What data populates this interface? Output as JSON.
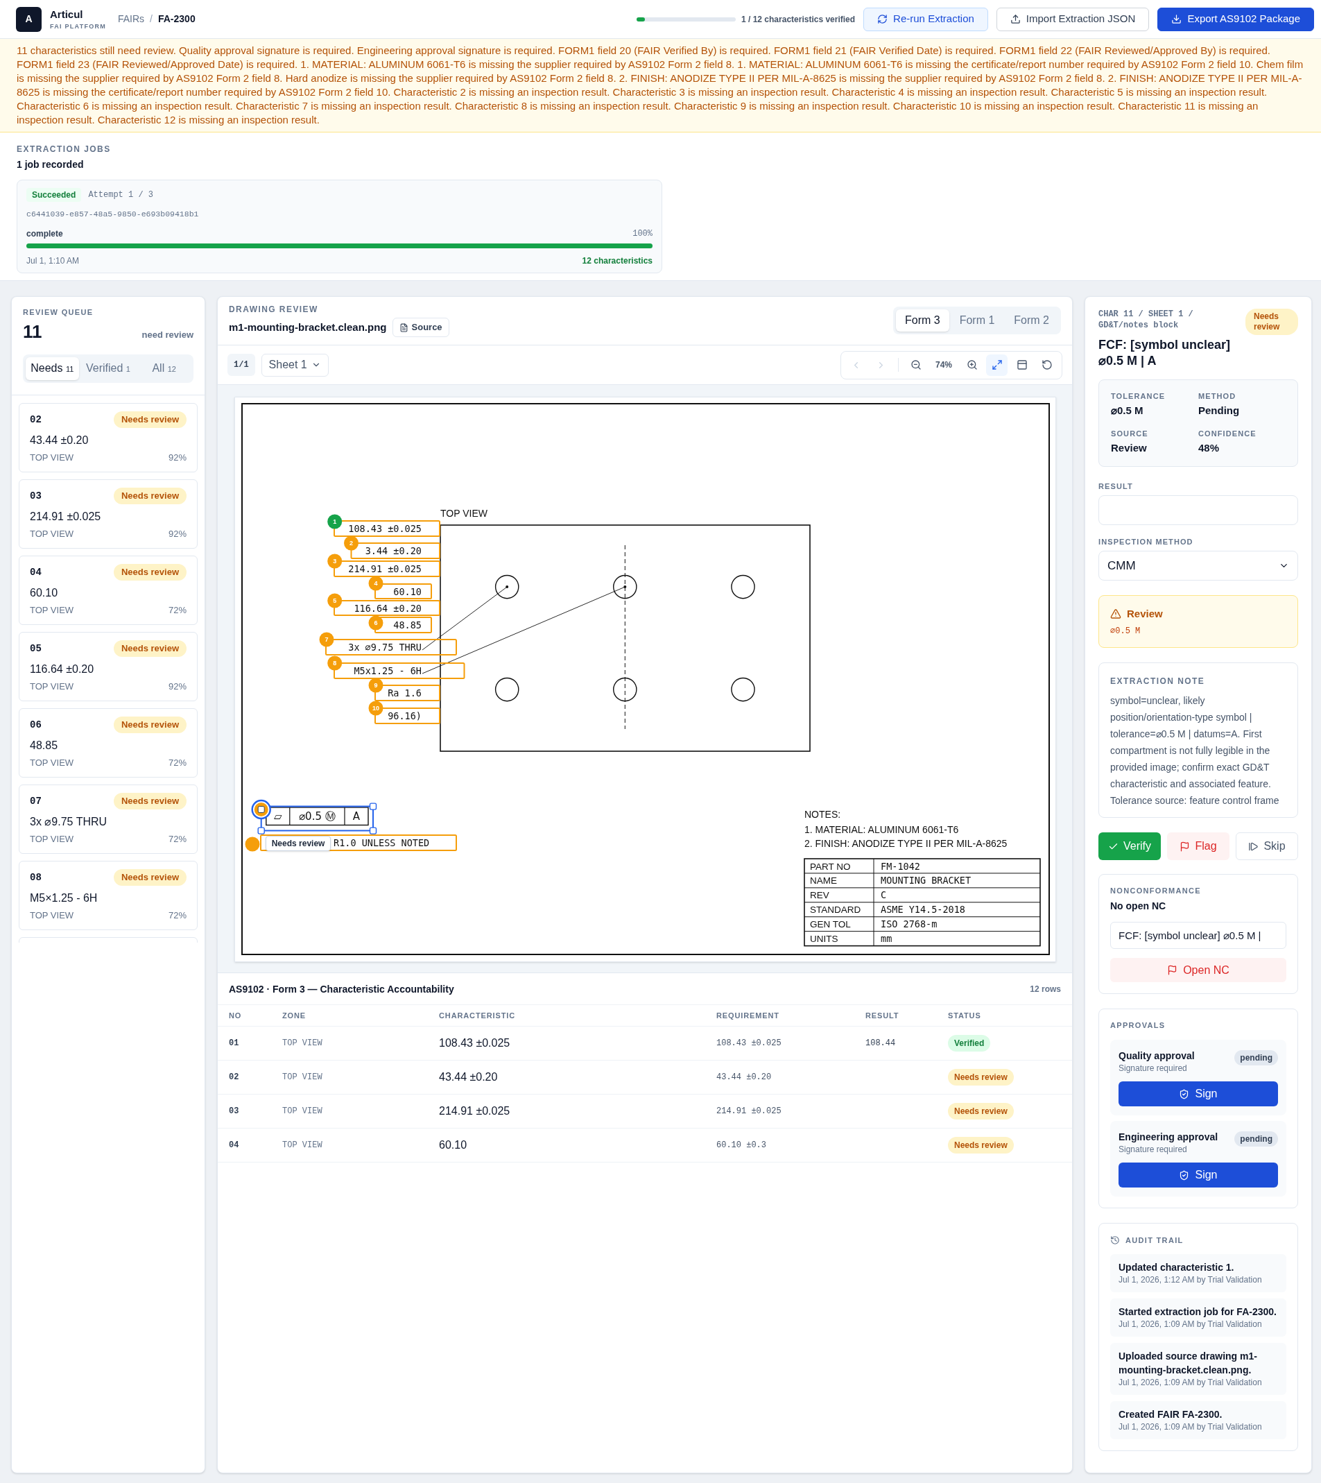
{
  "header": {
    "logo": "A",
    "brand": "Articul",
    "tagline": "FAI PLATFORM",
    "breadcrumb": {
      "items": [
        "FAIRs",
        "FA-2300"
      ],
      "separator": "/"
    },
    "progress": {
      "level": 0.083,
      "label": "1 / 12 characteristics verified"
    },
    "buttons": [
      {
        "label": "Re-run Extraction",
        "kind": "rerun"
      },
      {
        "label": "Import Extraction JSON",
        "kind": "import"
      },
      {
        "label": "Export AS9102 Package",
        "kind": "export"
      }
    ]
  },
  "warning": "11 characteristics still need review. Quality approval signature is required. Engineering approval signature is required. FORM1 field 20 (FAIR Verified By) is required. FORM1 field 21 (FAIR Verified Date) is required. FORM1 field 22 (FAIR Reviewed/Approved By) is required. FORM1 field 23 (FAIR Reviewed/Approved Date) is required. 1. MATERIAL: ALUMINUM 6061-T6 is missing the supplier required by AS9102 Form 2 field 8. 1. MATERIAL: ALUMINUM 6061-T6 is missing the certificate/report number required by AS9102 Form 2 field 10. Chem film is missing the supplier required by AS9102 Form 2 field 8. Hard anodize is missing the supplier required by AS9102 Form 2 field 8. 2. FINISH: ANODIZE TYPE II PER MIL-A-8625 is missing the supplier required by AS9102 Form 2 field 8. 2. FINISH: ANODIZE TYPE II PER MIL-A-8625 is missing the certificate/report number required by AS9102 Form 2 field 10. Characteristic 2 is missing an inspection result. Characteristic 3 is missing an inspection result. Characteristic 4 is missing an inspection result. Characteristic 5 is missing an inspection result. Characteristic 6 is missing an inspection result. Characteristic 7 is missing an inspection result. Characteristic 8 is missing an inspection result. Characteristic 9 is missing an inspection result. Characteristic 10 is missing an inspection result. Characteristic 11 is missing an inspection result. Characteristic 12 is missing an inspection result.",
  "extraction_jobs": {
    "title": "EXTRACTION JOBS",
    "summary": "1 job recorded",
    "jobs": [
      {
        "status": "Succeeded",
        "attempt": "Attempt 1 / 3",
        "uuid": "c6441039-e857-48a5-9850-e693b09418b1",
        "stage": "complete",
        "percent": "100%",
        "level": 1,
        "time": "Jul 1, 1:10 AM",
        "result": "12 characteristics"
      }
    ]
  },
  "review_queue": {
    "title": "REVIEW QUEUE",
    "count": "11",
    "count_label": "need review",
    "tabs": [
      {
        "label": "Needs",
        "count": "11",
        "selected": true
      },
      {
        "label": "Verified",
        "count": "1",
        "selected": false
      },
      {
        "label": "All",
        "count": "12",
        "selected": false
      }
    ],
    "items": [
      {
        "no": "02",
        "status": {
          "label": "Needs review",
          "kind": "review"
        },
        "value": "43.44 ±0.20",
        "zone": "TOP VIEW",
        "confidence": "92%"
      },
      {
        "no": "03",
        "status": {
          "label": "Needs review",
          "kind": "review"
        },
        "value": "214.91 ±0.025",
        "zone": "TOP VIEW",
        "confidence": "92%"
      },
      {
        "no": "04",
        "status": {
          "label": "Needs review",
          "kind": "review"
        },
        "value": "60.10",
        "zone": "TOP VIEW",
        "confidence": "72%"
      },
      {
        "no": "05",
        "status": {
          "label": "Needs review",
          "kind": "review"
        },
        "value": "116.64 ±0.20",
        "zone": "TOP VIEW",
        "confidence": "92%"
      },
      {
        "no": "06",
        "status": {
          "label": "Needs review",
          "kind": "review"
        },
        "value": "48.85",
        "zone": "TOP VIEW",
        "confidence": "72%"
      },
      {
        "no": "07",
        "status": {
          "label": "Needs review",
          "kind": "review"
        },
        "value": "3x ⌀9.75 THRU",
        "zone": "TOP VIEW",
        "confidence": "72%"
      },
      {
        "no": "08",
        "status": {
          "label": "Needs review",
          "kind": "review"
        },
        "value": "M5×1.25 - 6H",
        "zone": "TOP VIEW",
        "confidence": "72%"
      }
    ]
  },
  "drawing_review": {
    "title": "DRAWING REVIEW",
    "file": "m1-mounting-bracket.clean.png",
    "source_button": "Source",
    "form_tabs": [
      {
        "label": "Form 3",
        "selected": true
      },
      {
        "label": "Form 1",
        "selected": false
      },
      {
        "label": "Form 2",
        "selected": false
      }
    ],
    "page": "1/1",
    "sheet": "Sheet 1",
    "toolbar": {
      "zoom": "74%",
      "fit_selected": true,
      "nav_disabled": true
    },
    "drawing": {
      "view_label": "TOP VIEW",
      "callouts": [
        {
          "kind": "dimension",
          "number": "1",
          "text": "108.43 ±0.025",
          "verified": true,
          "selected": false
        },
        {
          "kind": "dimension",
          "number": "2",
          "text": "3.44 ±0.20",
          "verified": false,
          "selected": false
        },
        {
          "kind": "dimension",
          "number": "3",
          "text": "214.91 ±0.025",
          "verified": false,
          "selected": false
        },
        {
          "kind": "dimension",
          "number": "4",
          "text": "60.10",
          "verified": false,
          "selected": false
        },
        {
          "kind": "dimension",
          "number": "5",
          "text": "116.64 ±0.20",
          "verified": false,
          "selected": false
        },
        {
          "kind": "dimension",
          "number": "6",
          "text": "48.85",
          "verified": false,
          "selected": false
        },
        {
          "kind": "dimension",
          "number": "7",
          "text": "3x ⌀9.75 THRU",
          "verified": false,
          "selected": false
        },
        {
          "kind": "dimension",
          "number": "8",
          "text": "M5x1.25 - 6H",
          "verified": false,
          "selected": false
        },
        {
          "kind": "dimension",
          "number": "9",
          "text": "Ra 1.6",
          "verified": false,
          "selected": false
        },
        {
          "kind": "dimension",
          "number": "10",
          "text": "96.16)",
          "verified": false,
          "selected": false
        },
        {
          "kind": "fcf",
          "cells": [
            "▱",
            "⌀0.5 Ⓜ",
            "A"
          ],
          "verified": false,
          "selected": true,
          "tooltip": "Needs review"
        },
        {
          "kind": "dimension",
          "text": "R1.0 UNLESS NOTED",
          "verified": false,
          "selected": false
        }
      ],
      "notes": {
        "title": "NOTES:",
        "lines": [
          "1. MATERIAL: ALUMINUM 6061-T6",
          "2. FINISH: ANODIZE TYPE II PER MIL-A-8625"
        ]
      },
      "title_block": [
        {
          "label": "PART NO",
          "value": "FM-1042"
        },
        {
          "label": "NAME",
          "value": "MOUNTING BRACKET"
        },
        {
          "label": "REV",
          "value": "C"
        },
        {
          "label": "STANDARD",
          "value": "ASME Y14.5-2018"
        },
        {
          "label": "GEN TOL",
          "value": "ISO 2768-m"
        },
        {
          "label": "UNITS",
          "value": "mm"
        }
      ]
    },
    "table": {
      "title": "AS9102 · Form 3 — Characteristic Accountability",
      "row_count": "12 rows",
      "columns": [
        "NO",
        "ZONE",
        "CHARACTERISTIC",
        "REQUIREMENT",
        "RESULT",
        "STATUS"
      ],
      "rows": [
        {
          "no": "01",
          "zone": "TOP VIEW",
          "characteristic": "108.43 ±0.025",
          "requirement": "108.43 ±0.025",
          "result": "108.44",
          "status": {
            "label": "Verified",
            "kind": "verified"
          }
        },
        {
          "no": "02",
          "zone": "TOP VIEW",
          "characteristic": "43.44 ±0.20",
          "requirement": "43.44 ±0.20",
          "status": {
            "label": "Needs review",
            "kind": "review"
          }
        },
        {
          "no": "03",
          "zone": "TOP VIEW",
          "characteristic": "214.91 ±0.025",
          "requirement": "214.91 ±0.025",
          "status": {
            "label": "Needs review",
            "kind": "review"
          }
        },
        {
          "no": "04",
          "zone": "TOP VIEW",
          "characteristic": "60.10",
          "requirement": "60.10 ±0.3",
          "status": {
            "label": "Needs review",
            "kind": "review"
          }
        }
      ]
    }
  },
  "detail": {
    "breadcrumb": "CHAR 11 / SHEET 1 / GD&T/notes block",
    "status": {
      "label": "Needs review",
      "kind": "review"
    },
    "title": "FCF: [symbol unclear] ⌀0.5 M | A",
    "facts": [
      {
        "label": "TOLERANCE",
        "value": "⌀0.5 M"
      },
      {
        "label": "METHOD",
        "value": "Pending"
      },
      {
        "label": "SOURCE",
        "value": "Review"
      },
      {
        "label": "CONFIDENCE",
        "value": "48%"
      }
    ],
    "result_label": "RESULT",
    "method": {
      "label": "INSPECTION METHOD",
      "value": "CMM"
    },
    "alert": {
      "title": "Review",
      "detail": "⌀0.5 M"
    },
    "note": {
      "title": "EXTRACTION NOTE",
      "text": "symbol=unclear, likely position/orientation-type symbol | tolerance=⌀0.5 M | datums=A. First compartment is not fully legible in the provided image; confirm exact GD&T characteristic and associated feature. Tolerance source: feature control frame"
    },
    "actions": [
      {
        "label": "Verify",
        "kind": "verify"
      },
      {
        "label": "Flag",
        "kind": "flag"
      },
      {
        "label": "Skip",
        "kind": "skip"
      }
    ],
    "nonconformance": {
      "title": "NONCONFORMANCE",
      "status": "No open NC",
      "input_value": "FCF: [symbol unclear] ⌀0.5 M |",
      "button": "Open NC"
    },
    "approvals": {
      "title": "APPROVALS",
      "items": [
        {
          "name": "Quality approval",
          "detail": "Signature required",
          "status": "pending",
          "button": "Sign"
        },
        {
          "name": "Engineering approval",
          "detail": "Signature required",
          "status": "pending",
          "button": "Sign"
        }
      ]
    },
    "audit": {
      "title": "AUDIT TRAIL",
      "entries": [
        {
          "text": "Updated characteristic 1.",
          "meta": "Jul 1, 2026, 1:12 AM by Trial Validation"
        },
        {
          "text": "Started extraction job for FA-2300.",
          "meta": "Jul 1, 2026, 1:09 AM by Trial Validation"
        },
        {
          "text": "Uploaded source drawing m1-mounting-bracket.clean.png.",
          "meta": "Jul 1, 2026, 1:09 AM by Trial Validation"
        },
        {
          "text": "Created FAIR FA-2300.",
          "meta": "Jul 1, 2026, 1:09 AM by Trial Validation"
        }
      ]
    }
  }
}
